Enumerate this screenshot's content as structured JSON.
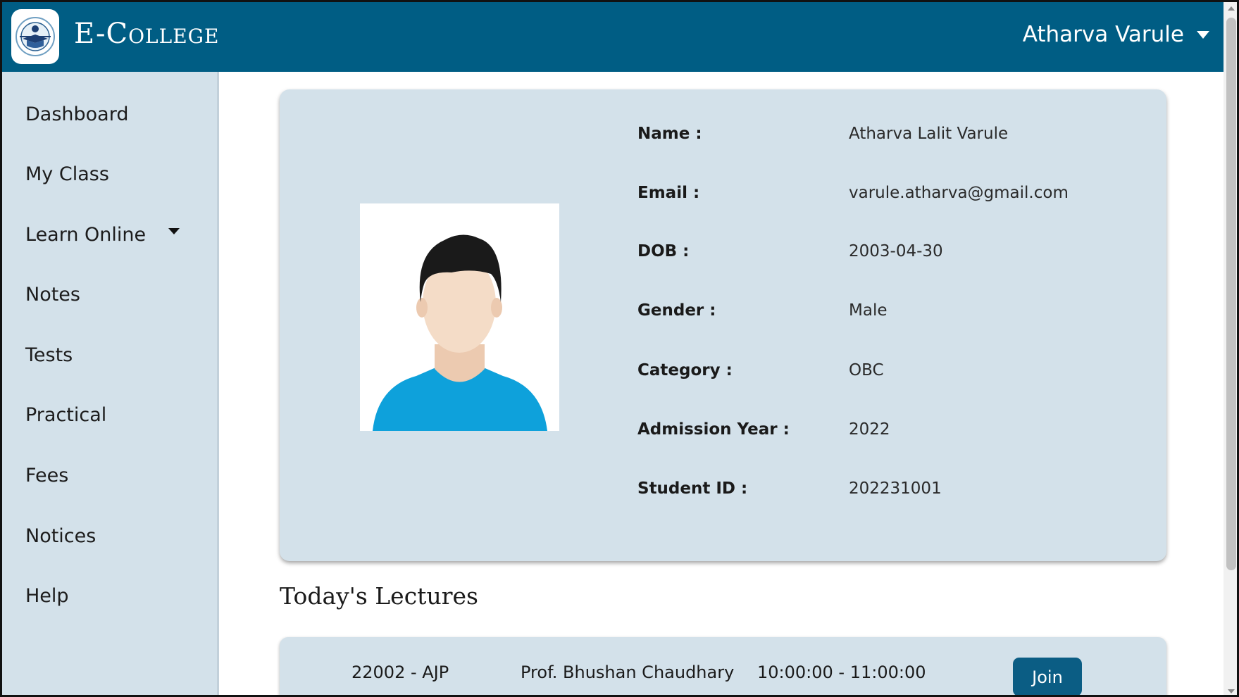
{
  "header": {
    "brand": "E-College",
    "logo_icon": "e-college-logo-icon",
    "user_name": "Atharva Varule",
    "bg_color": "#005d84"
  },
  "sidebar": {
    "items": [
      {
        "label": "Dashboard"
      },
      {
        "label": "My Class"
      },
      {
        "label": "Learn Online",
        "has_dropdown": true
      },
      {
        "label": "Notes"
      },
      {
        "label": "Tests"
      },
      {
        "label": "Practical"
      },
      {
        "label": "Fees"
      },
      {
        "label": "Notices"
      },
      {
        "label": "Help"
      }
    ]
  },
  "profile": {
    "photo_icon": "user-avatar-icon",
    "fields": [
      {
        "label": "Name :",
        "value": "Atharva Lalit Varule"
      },
      {
        "label": "Email :",
        "value": "varule.atharva@gmail.com"
      },
      {
        "label": "DOB :",
        "value": "2003-04-30"
      },
      {
        "label": "Gender :",
        "value": "Male"
      },
      {
        "label": "Category :",
        "value": "OBC"
      },
      {
        "label": "Admission Year :",
        "value": "2022"
      },
      {
        "label": "Student ID :",
        "value": "202231001"
      }
    ]
  },
  "lectures": {
    "title": "Today's Lectures",
    "rows": [
      {
        "subject": "22002 - AJP",
        "teacher": "Prof. Bhushan Chaudhary",
        "time": "10:00:00 - 11:00:00",
        "action": "Join"
      }
    ]
  },
  "colors": {
    "accent": "#005d84",
    "panel": "#d3e1ea",
    "button": "#0b5d84"
  }
}
